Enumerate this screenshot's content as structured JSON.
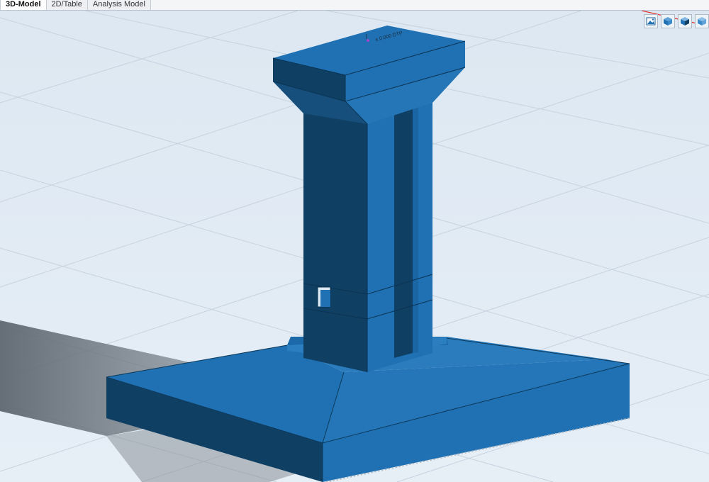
{
  "tabs": [
    {
      "label": "3D-Model",
      "active": true
    },
    {
      "label": "2D/Table",
      "active": false
    },
    {
      "label": "Analysis Model",
      "active": false
    }
  ],
  "viewport": {
    "background": "#dce8f2",
    "model_color": "#1f71b3",
    "model_dark": "#0f3f63",
    "elevation_label": "± 0.000 DTP",
    "toolbar_icons": [
      "view-image-icon",
      "cube-solid-icon",
      "cube-wire-icon",
      "cube-shaded-icon"
    ]
  }
}
